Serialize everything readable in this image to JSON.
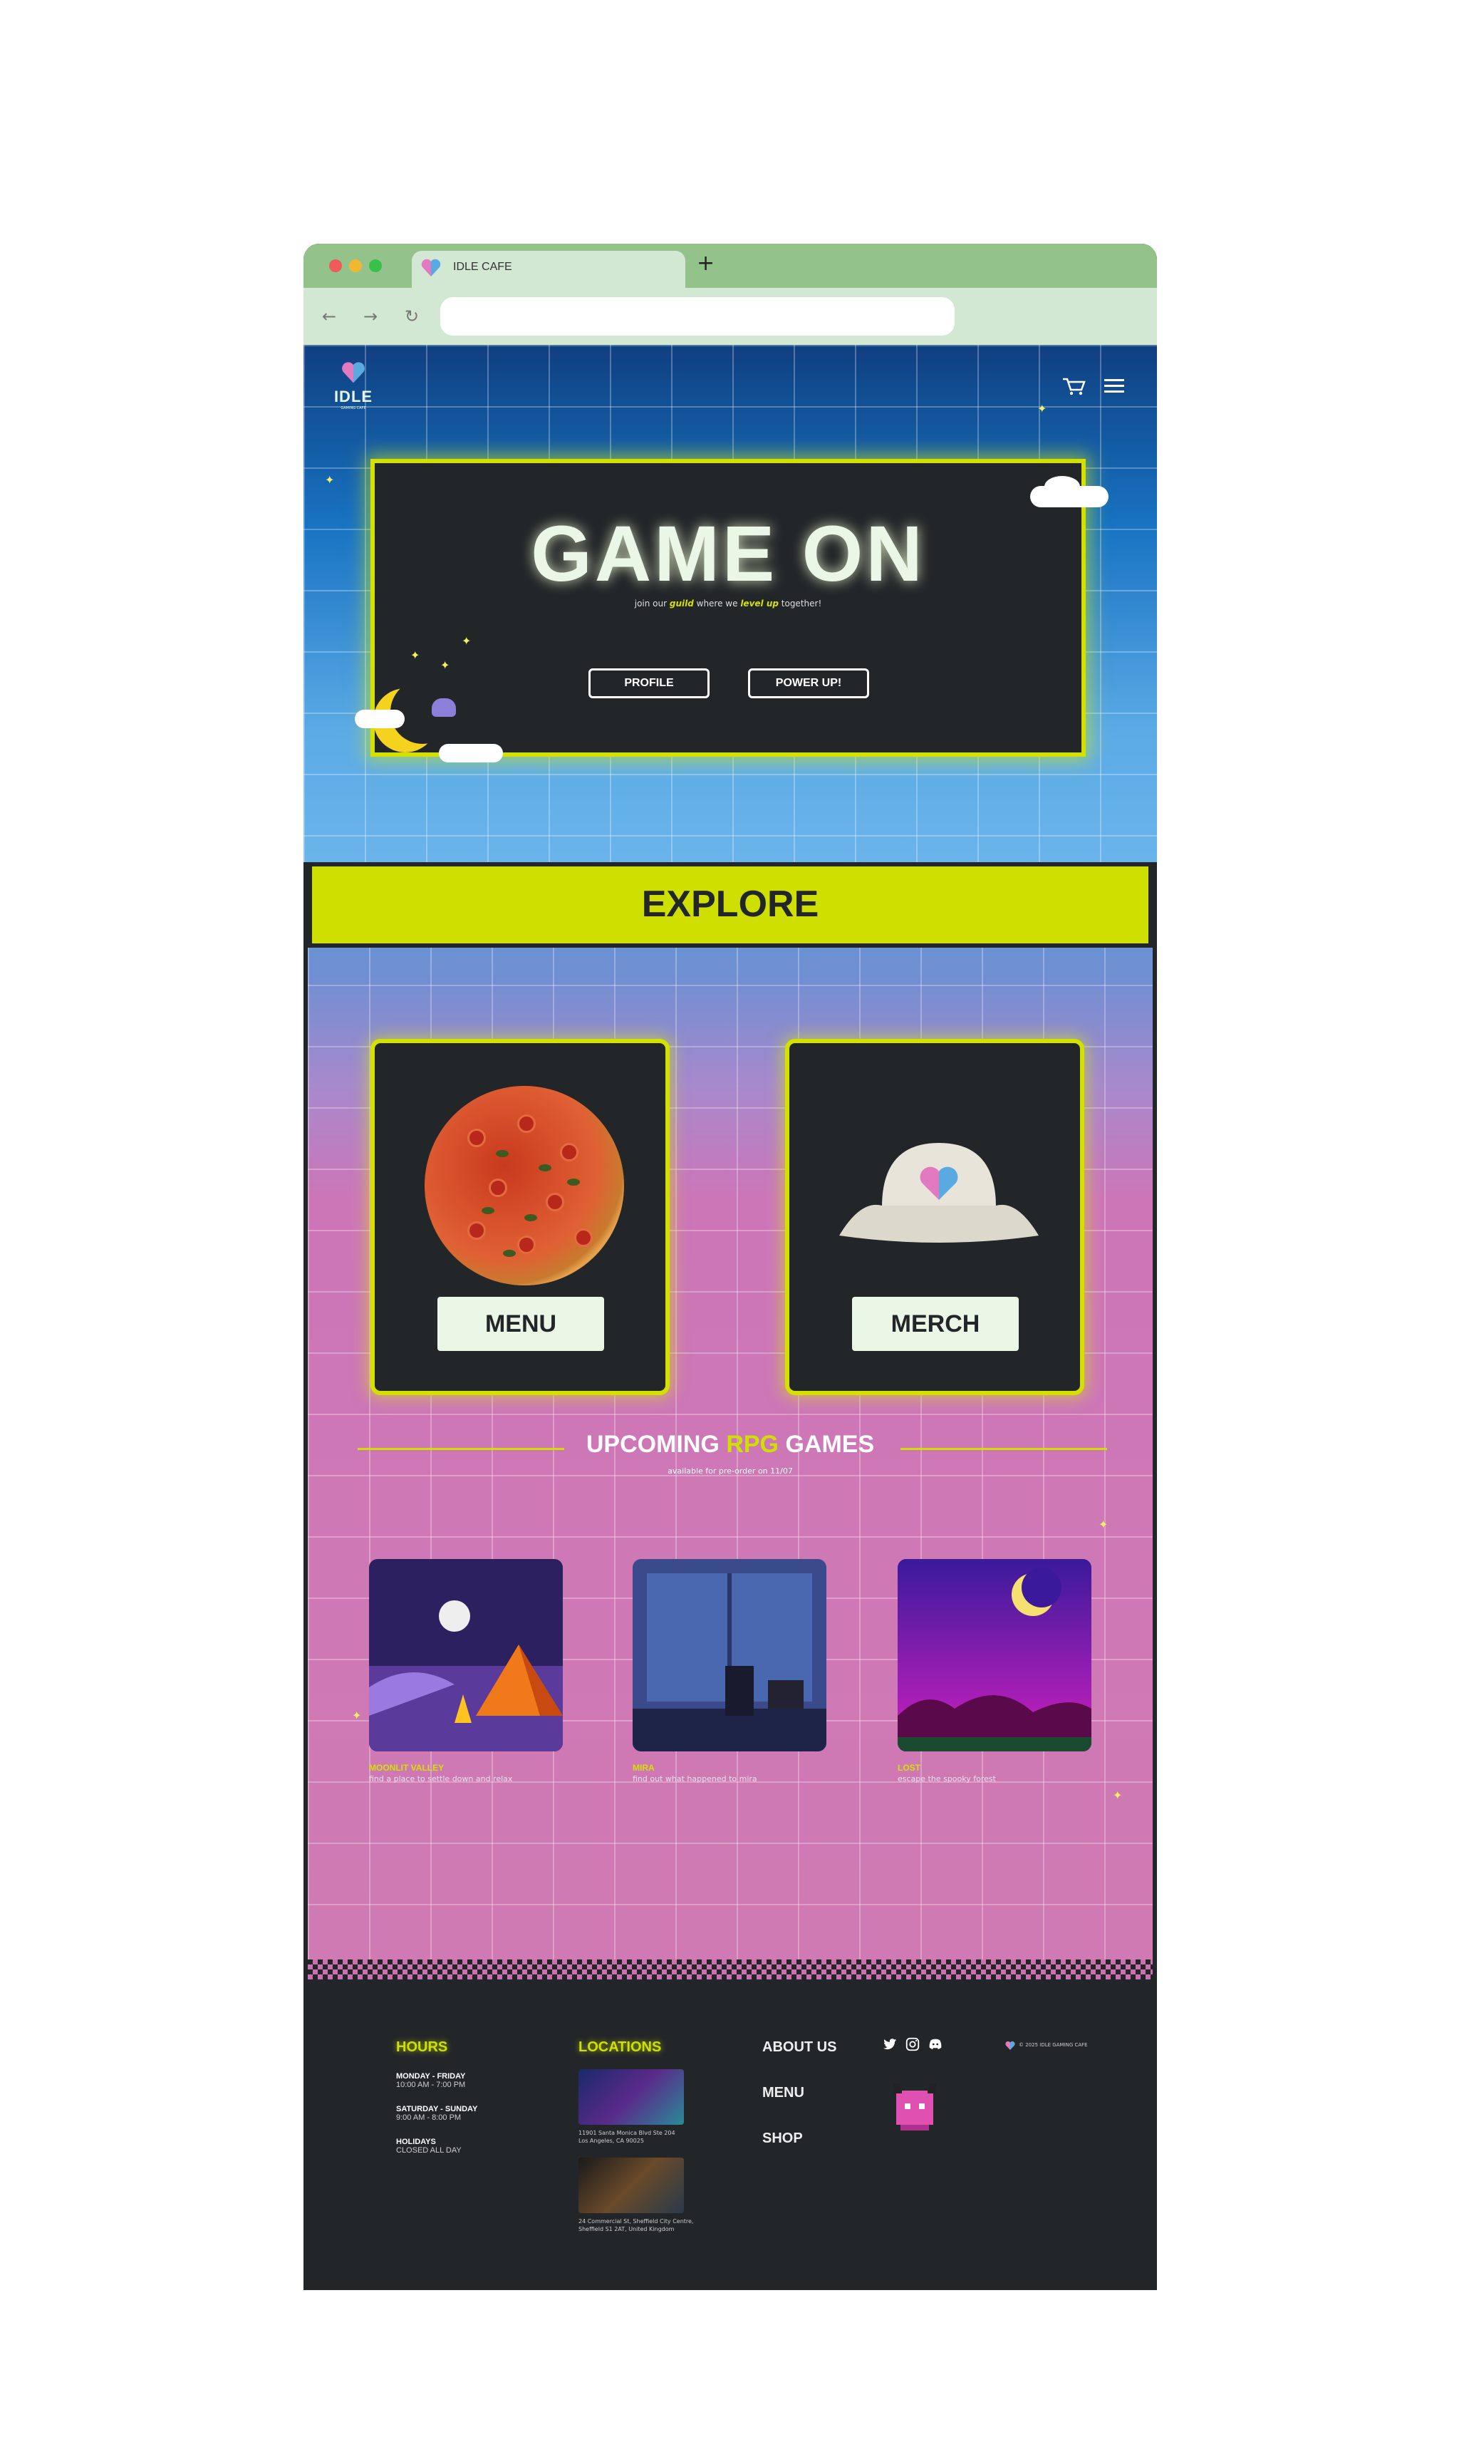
{
  "browser": {
    "tab_title": "IDLE CAFE",
    "new_tab": "+",
    "back": "←",
    "forward": "→",
    "reload": "↻"
  },
  "header": {
    "logo_text": "IDLE",
    "logo_sub": "GAMING CAFE"
  },
  "hero": {
    "title": "GAME ON",
    "tagline_pre": "join our ",
    "tagline_em1": "guild",
    "tagline_mid": " where we ",
    "tagline_em2": "level up",
    "tagline_post": " together!",
    "btn_profile": "PROFILE",
    "btn_power": "POWER UP!"
  },
  "explore": {
    "title": "EXPLORE",
    "menu_label": "MENU",
    "merch_label": "MERCH"
  },
  "upcoming": {
    "title_pre": "UPCOMING ",
    "title_hl": "RPG",
    "title_post": " GAMES",
    "subtitle": "available for pre-order on 11/07",
    "games": [
      {
        "name": "MOONLIT VALLEY",
        "desc": "find a place to settle down and relax"
      },
      {
        "name": "MIRA",
        "desc": "find out what happened to mira"
      },
      {
        "name": "LOST",
        "desc": "escape the spooky forest"
      }
    ]
  },
  "footer": {
    "hours_title": "HOURS",
    "hours": [
      {
        "day": "MONDAY - FRIDAY",
        "time": "10:00 AM - 7:00 PM"
      },
      {
        "day": "SATURDAY - SUNDAY",
        "time": "9:00 AM - 8:00 PM"
      },
      {
        "day": "HOLIDAYS",
        "time": "CLOSED ALL DAY"
      }
    ],
    "locations_title": "LOCATIONS",
    "locations": [
      {
        "line1": "11901 Santa Monica Blvd Ste 204",
        "line2": "Los Angeles, CA 90025"
      },
      {
        "line1": "24 Commercial St, Sheffield City Centre,",
        "line2": "Sheffield S1 2AT, United Kingdom"
      }
    ],
    "links": [
      "ABOUT US",
      "MENU",
      "SHOP"
    ],
    "copyright": "© 2025 IDLE GAMING CAFE"
  },
  "colors": {
    "accent": "#cfe000",
    "dark": "#232629",
    "cream": "#eaf6e6",
    "pink": "#d07ab3",
    "blue": "#1873c2"
  }
}
